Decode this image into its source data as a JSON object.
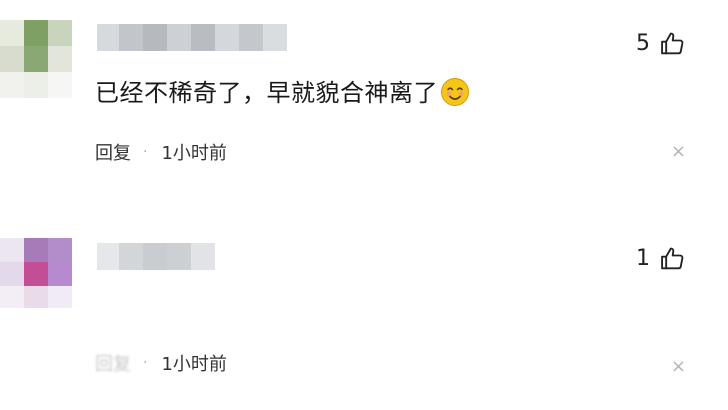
{
  "comments": [
    {
      "likes": "5",
      "text": "已经不稀奇了，早就貌合神离了",
      "reply_label": "回复",
      "separator": "·",
      "time": "1小时前",
      "close_glyph": "×"
    },
    {
      "likes": "1",
      "text": "",
      "reply_label": "回复",
      "separator": "·",
      "time": "1小时前",
      "close_glyph": "×"
    }
  ],
  "icons": {
    "like": "thumbs-up-icon",
    "emoji": "smiling-face-emoji",
    "close": "close-icon"
  },
  "colors": {
    "background": "#ffffff",
    "text": "#1a1a1a",
    "meta_text": "#333333",
    "close_icon": "#b5b5b5",
    "emoji_yellow": "#f5c518"
  }
}
